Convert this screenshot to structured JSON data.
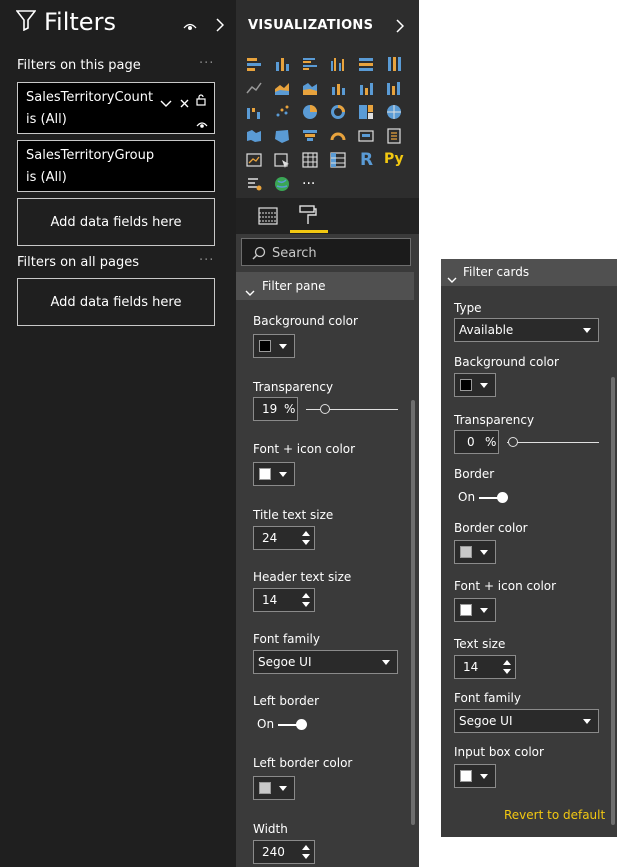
{
  "filters_pane": {
    "title": "Filters",
    "section_this_page": "Filters on this page",
    "section_all_pages": "Filters on all pages",
    "more": "···",
    "cards": [
      {
        "field": "SalesTerritoryCountry",
        "condition": "is (All)"
      },
      {
        "field": "SalesTerritoryGroup",
        "condition": "is (All)"
      }
    ],
    "add_fields": "Add data fields here",
    "add_fields_all": "Add data fields here"
  },
  "visualizations": {
    "title": "VISUALIZATIONS",
    "r_label": "R",
    "py_label": "Py",
    "more_label": "···",
    "search_placeholder": "Search",
    "filter_pane_header": "Filter pane",
    "background_color_label": "Background color",
    "background_color": "#000000",
    "transparency_label": "Transparency",
    "transparency_value": "19",
    "transparency_unit": "%",
    "font_icon_color_label": "Font + icon color",
    "font_icon_color": "#ffffff",
    "title_text_size_label": "Title text size",
    "title_text_size": "24",
    "header_text_size_label": "Header text size",
    "header_text_size": "14",
    "font_family_label": "Font family",
    "font_family": "Segoe UI",
    "left_border_label": "Left border",
    "left_border_state": "On",
    "left_border_color_label": "Left border color",
    "left_border_color": "#c8c8c8",
    "width_label": "Width",
    "width_value": "240"
  },
  "filter_cards": {
    "header": "Filter cards",
    "type_label": "Type",
    "type_value": "Available",
    "background_color_label": "Background color",
    "background_color": "#000000",
    "transparency_label": "Transparency",
    "transparency_value": "0",
    "transparency_unit": "%",
    "border_label": "Border",
    "border_state": "On",
    "border_color_label": "Border color",
    "border_color": "#c8c8c8",
    "font_icon_color_label": "Font + icon color",
    "font_icon_color": "#ffffff",
    "text_size_label": "Text size",
    "text_size": "14",
    "font_family_label": "Font family",
    "font_family": "Segoe UI",
    "input_box_color_label": "Input box color",
    "input_box_color": "#ffffff",
    "revert": "Revert to default"
  },
  "colors": {
    "accent_yellow": "#f2c811",
    "pane_dark": "#1f1f1f",
    "pane_mid": "#3a3a3a"
  }
}
